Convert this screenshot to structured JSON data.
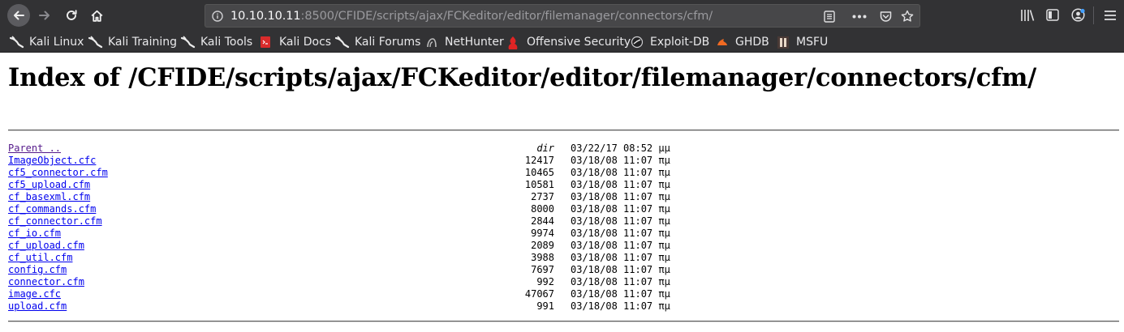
{
  "browser": {
    "url_host": "10.10.10.11",
    "url_rest": ":8500/CFIDE/scripts/ajax/FCKeditor/editor/filemanager/connectors/cfm/",
    "bookmarks": [
      {
        "label": "Kali Linux",
        "icon": "kali-dragon-icon"
      },
      {
        "label": "Kali Training",
        "icon": "kali-dragon-icon"
      },
      {
        "label": "Kali Tools",
        "icon": "kali-dragon-icon"
      },
      {
        "label": "Kali Docs",
        "icon": "kali-docs-icon"
      },
      {
        "label": "Kali Forums",
        "icon": "kali-dragon-icon"
      },
      {
        "label": "NetHunter",
        "icon": "nethunter-icon"
      },
      {
        "label": "Offensive Security",
        "icon": "offsec-icon"
      },
      {
        "label": "Exploit-DB",
        "icon": "exploitdb-icon"
      },
      {
        "label": "GHDB",
        "icon": "ghdb-icon"
      },
      {
        "label": "MSFU",
        "icon": "msfu-icon"
      }
    ]
  },
  "page": {
    "title": "Index of /CFIDE/scripts/ajax/FCKeditor/editor/filemanager/connectors/cfm/",
    "entries": [
      {
        "name": "Parent ..",
        "size": "dir",
        "date": "03/22/17 08:52 μμ"
      },
      {
        "name": "ImageObject.cfc",
        "size": "12417",
        "date": "03/18/08 11:07 πμ"
      },
      {
        "name": "cf5_connector.cfm",
        "size": "10465",
        "date": "03/18/08 11:07 πμ"
      },
      {
        "name": "cf5_upload.cfm",
        "size": "10581",
        "date": "03/18/08 11:07 πμ"
      },
      {
        "name": "cf_basexml.cfm",
        "size": "2737",
        "date": "03/18/08 11:07 πμ"
      },
      {
        "name": "cf_commands.cfm",
        "size": "8000",
        "date": "03/18/08 11:07 πμ"
      },
      {
        "name": "cf_connector.cfm",
        "size": "2844",
        "date": "03/18/08 11:07 πμ"
      },
      {
        "name": "cf_io.cfm",
        "size": "9974",
        "date": "03/18/08 11:07 πμ"
      },
      {
        "name": "cf_upload.cfm",
        "size": "2089",
        "date": "03/18/08 11:07 πμ"
      },
      {
        "name": "cf_util.cfm",
        "size": "3988",
        "date": "03/18/08 11:07 πμ"
      },
      {
        "name": "config.cfm",
        "size": "7697",
        "date": "03/18/08 11:07 πμ"
      },
      {
        "name": "connector.cfm",
        "size": "992",
        "date": "03/18/08 11:07 πμ"
      },
      {
        "name": "image.cfc",
        "size": "47067",
        "date": "03/18/08 11:07 πμ"
      },
      {
        "name": "upload.cfm",
        "size": "991",
        "date": "03/18/08 11:07 πμ"
      }
    ]
  },
  "colors": {
    "link": "#0000ee",
    "visited": "#551a8b",
    "chrome": "#323234"
  }
}
